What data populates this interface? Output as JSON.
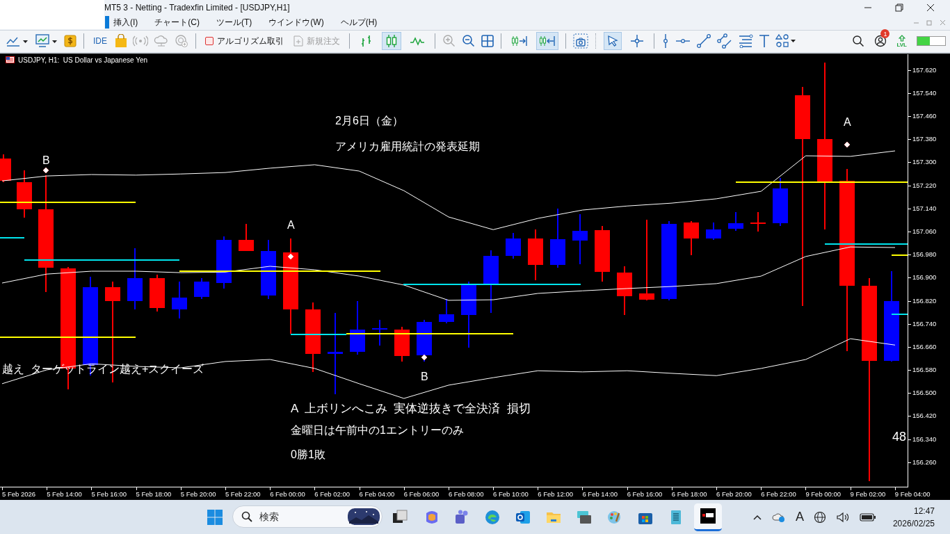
{
  "window": {
    "title": "MT5 3 - Netting - Tradexfin Limited - [USDJPY,H1]"
  },
  "menu": [
    "挿入(I)",
    "チャート(C)",
    "ツール(T)",
    "ウインドウ(W)",
    "ヘルプ(H)"
  ],
  "toolbar": {
    "text_buttons": [
      {
        "label": "IDE",
        "disabled": false
      },
      {
        "label": "アルゴリズム取引",
        "disabled": false
      },
      {
        "label": "新規注文",
        "disabled": true
      }
    ],
    "chart_type_buttons": [
      {
        "selected": false
      },
      {
        "selected": true
      },
      {
        "selected": false
      }
    ],
    "scroll_buttons": [
      {
        "selected": false
      },
      {
        "selected": true
      }
    ],
    "pointer_buttons": [
      {
        "selected": true
      },
      {
        "selected": false
      }
    ],
    "notification_badge": "1",
    "lvl_label": "LVL",
    "connection_meter": {
      "level": 0.45
    }
  },
  "chart": {
    "header": "USDJPY, H1:  US Dollar vs Japanese Yen",
    "annotations": [
      {
        "kind": "marker",
        "text": "B"
      },
      {
        "kind": "marker",
        "text": "A"
      },
      {
        "kind": "marker",
        "text": "A"
      },
      {
        "kind": "marker",
        "text": "B"
      },
      {
        "kind": "note",
        "text": "2月6日（金）"
      },
      {
        "kind": "note",
        "text": "アメリカ雇用統計の発表延期"
      },
      {
        "kind": "note",
        "text": "越え  ターゲットライン越え+スクイーズ"
      },
      {
        "kind": "note",
        "text": "A  上ボリンへこみ  実体逆抜きで全決済  損切"
      },
      {
        "kind": "note",
        "text": "金曜日は午前中の1エントリーのみ"
      },
      {
        "kind": "note",
        "text": "0勝1敗"
      },
      {
        "kind": "note",
        "text": "48"
      }
    ],
    "chart_data": {
      "type": "line",
      "categories": [
        "5 Feb 2026",
        "5 Feb 14:00",
        "5 Feb 16:00",
        "5 Feb 18:00",
        "5 Feb 20:00",
        "5 Feb 22:00",
        "6 Feb 00:00",
        "6 Feb 02:00",
        "6 Feb 04:00",
        "6 Feb 06:00",
        "6 Feb 08:00",
        "6 Feb 10:00",
        "6 Feb 12:00",
        "6 Feb 14:00",
        "6 Feb 16:00",
        "6 Feb 18:00",
        "6 Feb 20:00",
        "6 Feb 22:00",
        "9 Feb 00:00",
        "9 Feb 02:00",
        "9 Feb 04:00"
      ],
      "series": [
        {
          "color": "#ffffff",
          "values": [
            157.239,
            157.256,
            157.261,
            157.259,
            157.263,
            157.268,
            157.283,
            157.295,
            157.273,
            157.205,
            157.114,
            157.07,
            157.109,
            157.138,
            157.152,
            157.162,
            157.177,
            157.203,
            157.326,
            157.324,
            157.343
          ]
        },
        {
          "color": "#ffffff",
          "values": [
            156.885,
            156.916,
            156.926,
            156.926,
            156.921,
            156.923,
            156.943,
            156.931,
            156.909,
            156.878,
            156.825,
            156.827,
            156.849,
            156.858,
            156.866,
            156.873,
            156.883,
            156.909,
            156.977,
            157.01,
            157.008
          ]
        },
        {
          "color": "#ffffff",
          "values": [
            156.536,
            156.584,
            156.605,
            156.596,
            156.591,
            156.613,
            156.62,
            156.589,
            156.536,
            156.485,
            156.531,
            156.557,
            156.581,
            156.577,
            156.581,
            156.572,
            156.564,
            156.589,
            156.62,
            156.692,
            156.67
          ]
        }
      ],
      "ylim": [
        156.179,
        157.678
      ],
      "yticks": [
        {
          "value": 157.62,
          "label": "157.620"
        },
        {
          "value": 157.54,
          "label": "157.540"
        },
        {
          "value": 157.46,
          "label": "157.460"
        },
        {
          "value": 157.38,
          "label": "157.380"
        },
        {
          "value": 157.3,
          "label": "157.300"
        },
        {
          "value": 157.22,
          "label": "157.220"
        },
        {
          "value": 157.14,
          "label": "157.140"
        },
        {
          "value": 157.06,
          "label": "157.060"
        },
        {
          "value": 156.98,
          "label": "156.980"
        },
        {
          "value": 156.9,
          "label": "156.900"
        },
        {
          "value": 156.82,
          "label": "156.820"
        },
        {
          "value": 156.74,
          "label": "156.740"
        },
        {
          "value": 156.66,
          "label": "156.660"
        },
        {
          "value": 156.58,
          "label": "156.580"
        },
        {
          "value": 156.5,
          "label": "156.500"
        },
        {
          "value": 156.42,
          "label": "156.420"
        },
        {
          "value": 156.34,
          "label": "156.340"
        },
        {
          "value": 156.26,
          "label": "156.260"
        }
      ]
    }
  },
  "taskbar": {
    "search_placeholder": "検索",
    "apps": [
      {
        "kind": "task-view",
        "selected": false
      },
      {
        "kind": "copilot",
        "selected": false
      },
      {
        "kind": "teams",
        "selected": false
      },
      {
        "kind": "edge",
        "selected": false
      },
      {
        "kind": "outlook",
        "selected": false
      },
      {
        "kind": "folder",
        "selected": false
      },
      {
        "kind": "keyboard",
        "selected": false
      },
      {
        "kind": "paint",
        "selected": false
      },
      {
        "kind": "store",
        "selected": false
      },
      {
        "kind": "notepad",
        "selected": false
      },
      {
        "kind": "xm",
        "selected": true
      }
    ],
    "ime": "A",
    "time": "12:47",
    "date": "2026/02/25"
  }
}
